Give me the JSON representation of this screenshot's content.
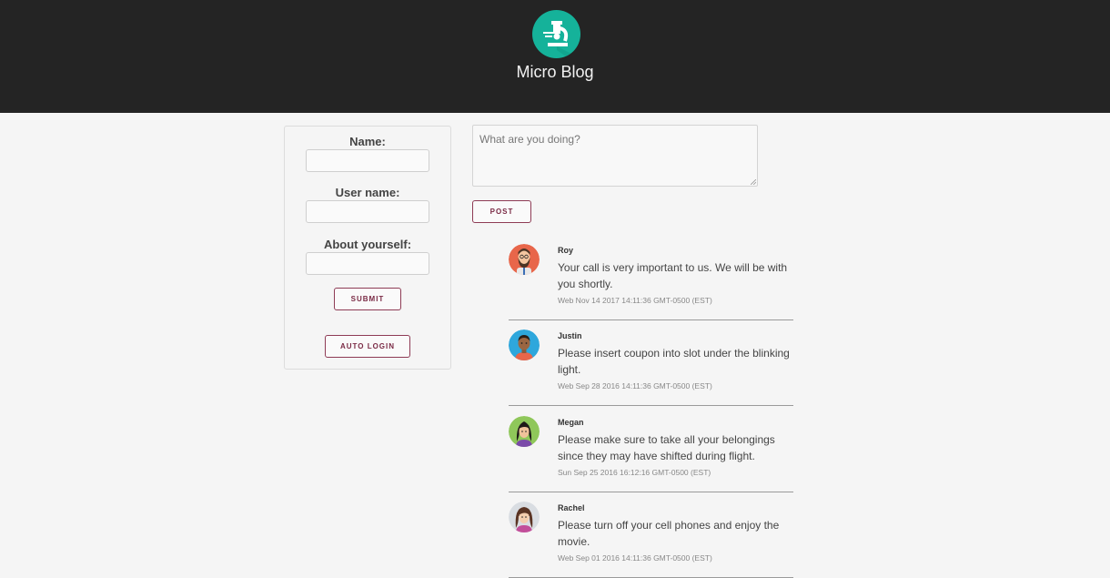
{
  "header": {
    "title": "Micro Blog",
    "logo_icon": "microscope-icon",
    "logo_color": "#15b29a"
  },
  "profile_form": {
    "name_label": "Name:",
    "name_value": "",
    "username_label": "User name:",
    "username_value": "",
    "about_label": "About yourself:",
    "about_value": "",
    "submit_label": "SUBMIT",
    "auto_login_label": "AUTO LOGIN"
  },
  "composer": {
    "placeholder": "What are you doing?",
    "post_label": "POST"
  },
  "accent_color": "#8e3b55",
  "posts": [
    {
      "author": "Roy",
      "avatar_icon": "bearded-man-avatar-icon",
      "message": "Your call is very important to us. We will be with you shortly.",
      "timestamp": "Web Nov 14 2017 14:11:36 GMT-0500 (EST)"
    },
    {
      "author": "Justin",
      "avatar_icon": "man-avatar-icon",
      "message": "Please insert coupon into slot under the blinking light.",
      "timestamp": "Web Sep 28 2016 14:11:36 GMT-0500 (EST)"
    },
    {
      "author": "Megan",
      "avatar_icon": "woman-dark-hair-avatar-icon",
      "message": "Please make sure to take all your belongings since they may have shifted during flight.",
      "timestamp": "Sun Sep 25 2016 16:12:16 GMT-0500 (EST)"
    },
    {
      "author": "Rachel",
      "avatar_icon": "woman-brown-hair-avatar-icon",
      "message": "Please turn off your cell phones and enjoy the movie.",
      "timestamp": "Web Sep 01 2016 14:11:36 GMT-0500 (EST)"
    }
  ]
}
